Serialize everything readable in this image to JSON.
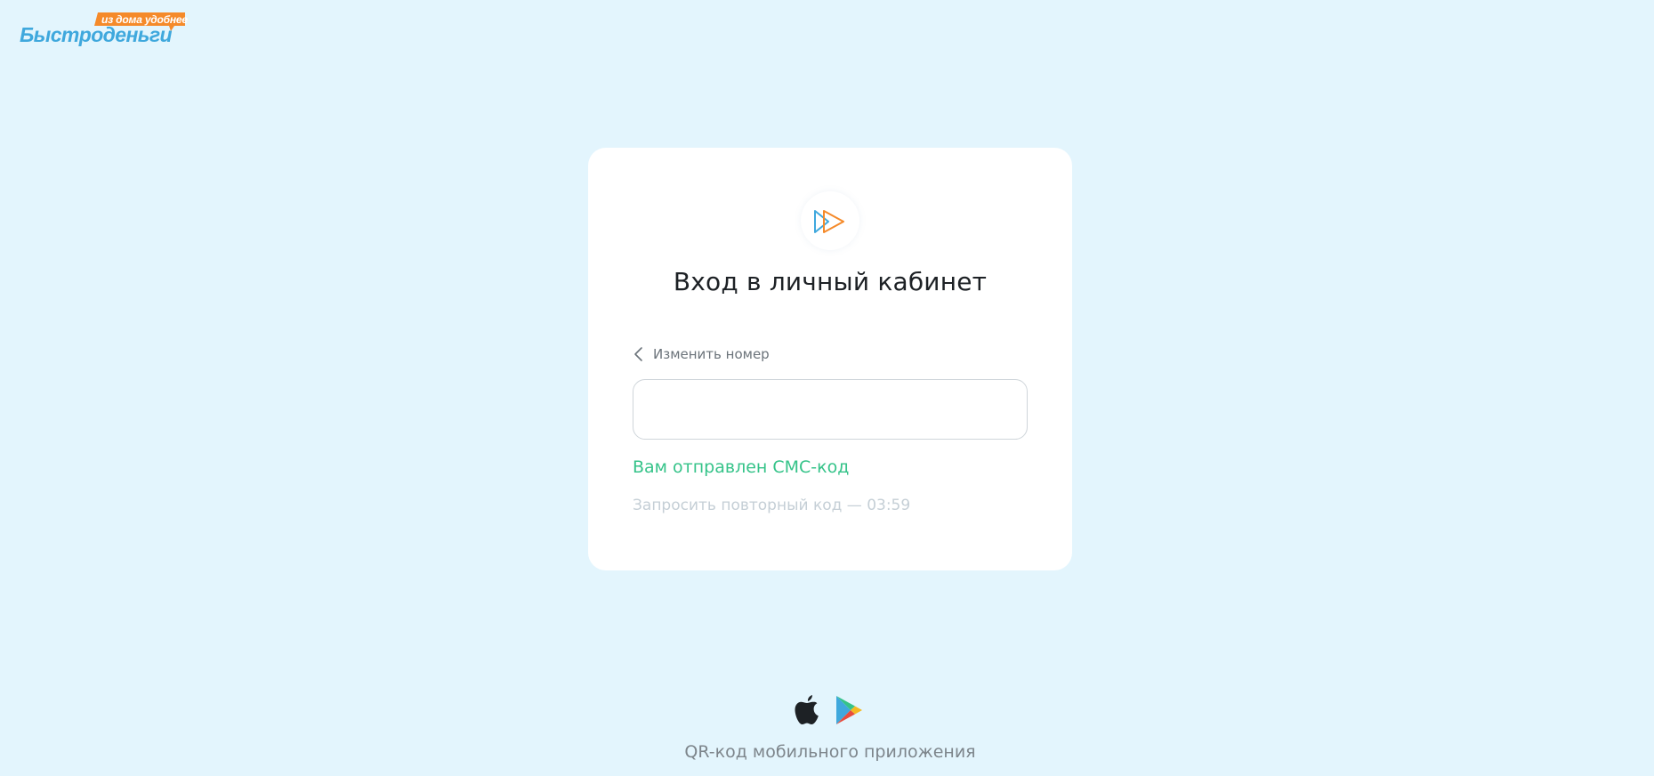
{
  "logo": {
    "wordmark": "Быстроденьги",
    "tagline": "из дома удобнее"
  },
  "login": {
    "title": "Вход в личный кабинет",
    "change_number": "Изменить номер",
    "code_value": "",
    "sms_sent": "Вам отправлен СМС-код",
    "resend_text": "Запросить повторный код — 03:59"
  },
  "footer": {
    "qr_caption": "QR-код мобильного приложения"
  },
  "icons": {
    "brand": "play-arrows-icon",
    "back": "chevron-left-icon",
    "app_store": "apple-icon",
    "google_play": "google-play-icon"
  },
  "colors": {
    "page_background": "#e3f5fd",
    "logo_blue": "#3fa8dd",
    "logo_orange": "#f58a2a",
    "success_green": "#35c389",
    "muted_text": "#c5cfd6"
  }
}
